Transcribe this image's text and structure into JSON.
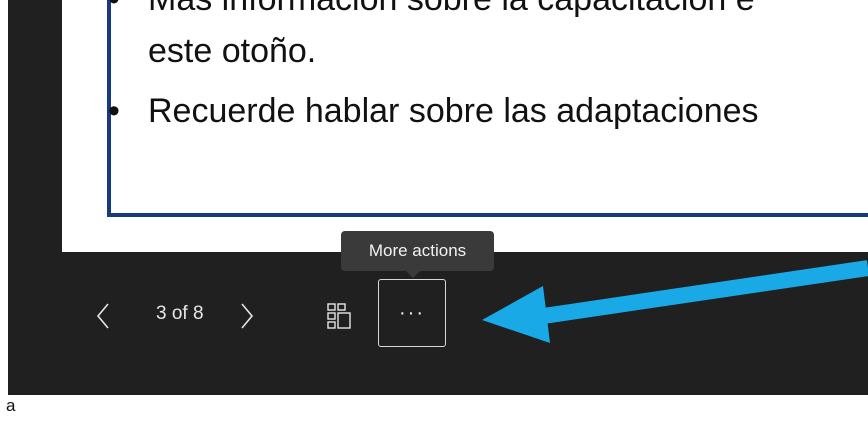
{
  "slide": {
    "bullet1_line1": "Más información sobre la capacitación e",
    "bullet1_line2": "este otoño.",
    "bullet2": "Recuerde hablar sobre las adaptaciones",
    "bullet_glyph": "•"
  },
  "toolbar": {
    "prev_glyph": "〈",
    "page_indicator": "3 of 8",
    "next_glyph": "〉",
    "more_label": "···",
    "tooltip": "More actions"
  },
  "edge": {
    "letter": "a"
  },
  "colors": {
    "viewer_bg": "#202020",
    "slide_border": "#17397d",
    "tooltip_bg": "#3a3a3a",
    "annotation_arrow": "#18a9e6"
  },
  "icons": [
    "chevron-left-icon",
    "chevron-right-icon",
    "thumbnails-icon",
    "more-dots-icon",
    "arrow-annotation-icon"
  ]
}
